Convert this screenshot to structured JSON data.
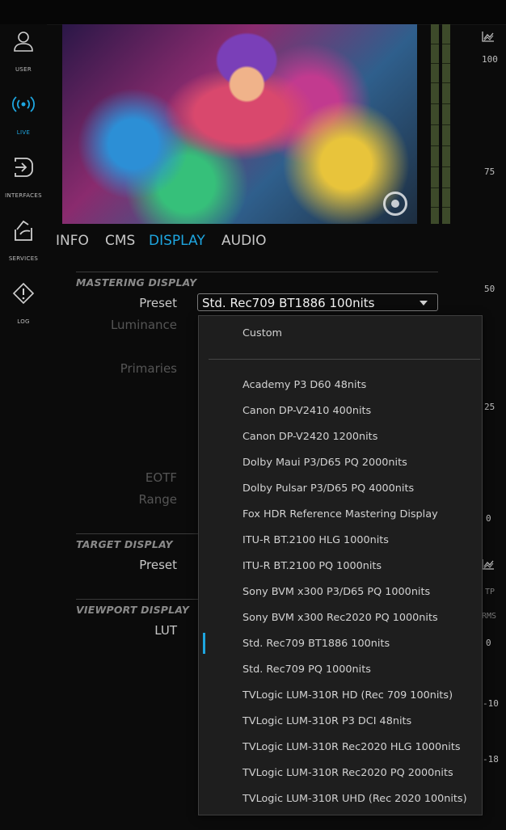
{
  "sidebar": {
    "items": [
      {
        "label": "USER",
        "icon": "user-icon",
        "active": false
      },
      {
        "label": "LIVE",
        "icon": "broadcast-icon",
        "active": true
      },
      {
        "label": "INTERFACES",
        "icon": "login-arrow-icon",
        "active": false
      },
      {
        "label": "SERVICES",
        "icon": "services-icon",
        "active": false
      },
      {
        "label": "LOG",
        "icon": "warning-icon",
        "active": false
      }
    ]
  },
  "tabs": [
    {
      "label": "INFO",
      "active": false
    },
    {
      "label": "CMS",
      "active": false
    },
    {
      "label": "DISPLAY",
      "active": true
    },
    {
      "label": "AUDIO",
      "active": false
    }
  ],
  "scale_top": [
    "100",
    "75",
    "50",
    "25",
    "0"
  ],
  "scale_bottom": {
    "tp": "TP",
    "rms": "RMS",
    "values": [
      "0",
      "-10",
      "-18"
    ]
  },
  "mastering": {
    "title": "MASTERING DISPLAY",
    "preset_label": "Preset",
    "preset_value": "Std. Rec709 BT1886 100nits",
    "luminance_label": "Luminance",
    "primaries_label": "Primaries",
    "eotf_label": "EOTF",
    "range_label": "Range"
  },
  "target": {
    "title": "TARGET DISPLAY",
    "preset_label": "Preset"
  },
  "viewport": {
    "title": "VIEWPORT DISPLAY",
    "lut_label": "LUT"
  },
  "dropdown": {
    "custom": "Custom",
    "selected_index": 10,
    "options": [
      "Academy P3 D60 48nits",
      "Canon DP-V2410 400nits",
      "Canon DP-V2420 1200nits",
      "Dolby Maui P3/D65 PQ 2000nits",
      "Dolby Pulsar P3/D65 PQ 4000nits",
      "Fox HDR Reference Mastering Display",
      "ITU-R BT.2100 HLG 1000nits",
      "ITU-R BT.2100 PQ 1000nits",
      "Sony BVM x300 P3/D65 PQ 1000nits",
      "Sony BVM x300 Rec2020 PQ 1000nits",
      "Std. Rec709 BT1886 100nits",
      "Std. Rec709 PQ 1000nits",
      "TVLogic LUM-310R HD (Rec 709 100nits)",
      "TVLogic LUM-310R P3 DCI 48nits",
      "TVLogic LUM-310R Rec2020 HLG 1000nits",
      "TVLogic LUM-310R Rec2020 PQ 2000nits",
      "TVLogic LUM-310R UHD (Rec 2020 100nits)"
    ]
  },
  "colors": {
    "accent": "#1ea6e0",
    "background": "#0b0b0b",
    "dropdown_bg": "#1e1e1e",
    "meter": "#3d4a2a"
  }
}
